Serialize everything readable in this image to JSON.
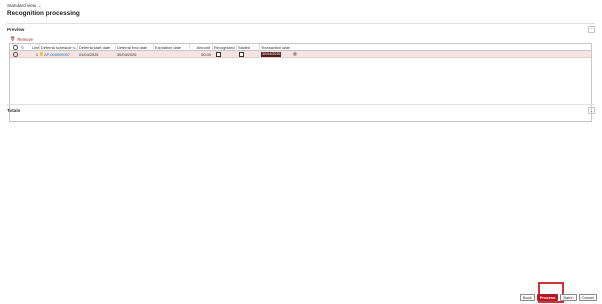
{
  "header": {
    "view_label": "Standard view",
    "title": "Recognition processing"
  },
  "preview": {
    "title": "Preview",
    "remove_label": "Remove",
    "columns": {
      "line": "Line",
      "schedule": "Deferral schedule n...",
      "start": "Deferral start date",
      "end": "Deferral end date",
      "expiration": "Expiration date",
      "amount": "Amount",
      "recognized": "Recognized",
      "stalled": "Stalled",
      "transaction": "Transaction date"
    },
    "rows": [
      {
        "line": "1",
        "schedule": "AP-000000007",
        "start": "01/04/2025",
        "end": "30/04/2025",
        "expiration": "",
        "amount": "50.00",
        "recognized": false,
        "stalled": false,
        "transaction": "30/04/2025"
      }
    ]
  },
  "totals": {
    "title": "Totals"
  },
  "footer": {
    "back_label": "Back",
    "process_label": "Process",
    "batch_label": "Batch",
    "cancel_label": "Cancel"
  },
  "icons": {
    "view_chevron": "chevron-down-icon",
    "collapse": "chevron-up-icon",
    "expand": "chevron-down-icon",
    "remove": "trash-icon",
    "refresh": "refresh-icon",
    "calendar": "calendar-icon"
  },
  "colors": {
    "accent": "#c50f1f",
    "selected_row": "#f4e4e4",
    "link": "#0f6cbd",
    "highlight": "#d13438"
  }
}
